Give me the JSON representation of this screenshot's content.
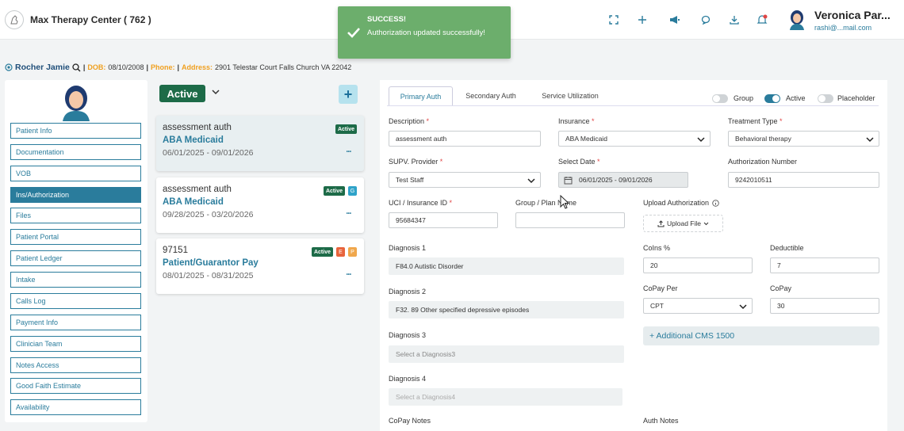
{
  "header": {
    "app_title": "Max Therapy Center ( 762 )",
    "icons": [
      "fullscreen-icon",
      "plus-icon",
      "megaphone-icon",
      "chat-icon",
      "download-icon",
      "bell-icon"
    ],
    "user_name": "Veronica Par...",
    "user_email": "rashi@...mail.com"
  },
  "toast": {
    "title": "SUCCESS!",
    "message": "Authorization updated successfully!",
    "color": "#6cae6c"
  },
  "patient": {
    "name": "Rocher Jamie",
    "sep": "|",
    "dob_label": "DOB:",
    "dob": "08/10/2008",
    "phone_label": "Phone:",
    "address_label": "Address:",
    "address": "2901 Telestar Court Falls Church VA 22042"
  },
  "sidebar": {
    "items": [
      {
        "label": "Patient Info"
      },
      {
        "label": "Documentation"
      },
      {
        "label": "VOB"
      },
      {
        "label": "Ins/Authorization"
      },
      {
        "label": "Files"
      },
      {
        "label": "Patient Portal"
      },
      {
        "label": "Patient Ledger"
      },
      {
        "label": "Intake"
      },
      {
        "label": "Calls Log"
      },
      {
        "label": "Payment Info"
      },
      {
        "label": "Clinician Team"
      },
      {
        "label": "Notes Access"
      },
      {
        "label": "Good Faith Estimate"
      },
      {
        "label": "Availability"
      }
    ],
    "active_index": 3
  },
  "auth_list": {
    "filter_label": "Active",
    "cards": [
      {
        "title": "assessment auth",
        "subtitle": "ABA Medicaid",
        "dates": "06/01/2025 - 09/01/2026",
        "badge": "Active",
        "extra": []
      },
      {
        "title": "assessment auth",
        "subtitle": "ABA Medicaid",
        "dates": "09/28/2025 - 03/20/2026",
        "badge": "Active",
        "extra": [
          "G"
        ]
      },
      {
        "title": "97151",
        "subtitle": "Patient/Guarantor Pay",
        "dates": "08/01/2025 - 08/31/2025",
        "badge": "Active",
        "extra": [
          "E",
          "P"
        ]
      }
    ]
  },
  "form": {
    "tabs": [
      "Primary Auth",
      "Secondary Auth",
      "Service Utilization"
    ],
    "toggles": [
      {
        "label": "Group",
        "on": false
      },
      {
        "label": "Active",
        "on": true
      },
      {
        "label": "Placeholder",
        "on": false
      }
    ],
    "description_label": "Description",
    "description_value": "assessment auth",
    "insurance_label": "Insurance",
    "insurance_value": "ABA Medicaid",
    "treatment_type_label": "Treatment Type",
    "treatment_type_value": "Behavioral therapy",
    "supv_label": "SUPV. Provider",
    "supv_value": "Test Staff",
    "select_date_label": "Select Date",
    "select_date_value": "06/01/2025 - 09/01/2026",
    "auth_number_label": "Authorization Number",
    "auth_number_value": "9242010511",
    "uci_label": "UCI / Insurance ID",
    "uci_value": "95684347",
    "group_label": "Group / Plan Name",
    "group_value": "",
    "upload_label": "Upload Authorization",
    "upload_button": "Upload File",
    "dx1_label": "Diagnosis 1",
    "dx1_value": "F84.0 Autistic Disorder",
    "dx2_label": "Diagnosis 2",
    "dx2_value": "F32. 89 Other specified depressive episodes",
    "dx3_label": "Diagnosis 3",
    "dx3_placeholder": "Select a Diagnosis3",
    "dx4_label": "Diagnosis 4",
    "dx4_placeholder": "Select a Diagnosis4",
    "coins_label": "CoIns %",
    "coins_value": "20",
    "deductible_label": "Deductible",
    "deductible_value": "7",
    "copay_per_label": "CoPay Per",
    "copay_per_value": "CPT",
    "copay_label": "CoPay",
    "copay_value": "30",
    "additional_cms": "+ Additional CMS 1500",
    "copay_notes_label": "CoPay Notes",
    "auth_notes_label": "Auth Notes"
  },
  "colors": {
    "primary": "#2a7c9c",
    "active_green": "#1d6b48",
    "required": "#e04545"
  }
}
